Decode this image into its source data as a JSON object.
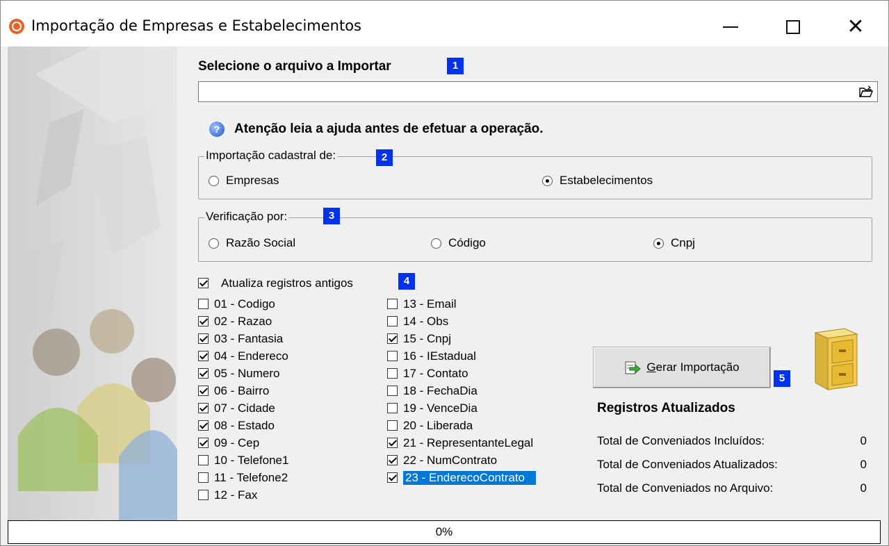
{
  "window": {
    "title": "Importação de Empresas e Estabelecimentos",
    "icons": {
      "app": "app-icon",
      "minimize": "minimize-icon",
      "maximize": "maximize-icon",
      "close": "close-icon"
    }
  },
  "file": {
    "heading": "Selecione o arquivo a Importar",
    "badge": "1",
    "value": "",
    "browse_icon": "open-folder-icon"
  },
  "help": {
    "text": "Atenção leia a ajuda antes de efetuar a operação.",
    "icon": "help-icon"
  },
  "import_type": {
    "legend": "Importação cadastral de:",
    "badge": "2",
    "options": [
      {
        "label": "Empresas",
        "selected": false
      },
      {
        "label": "Estabelecimentos",
        "selected": true
      }
    ]
  },
  "verification": {
    "legend": "Verificação por:",
    "badge": "3",
    "options": [
      {
        "label": "Razão Social",
        "selected": false
      },
      {
        "label": "Código",
        "selected": false
      },
      {
        "label": "Cnpj",
        "selected": true
      }
    ]
  },
  "update_old": {
    "label": "Atualiza registros antigos",
    "checked": true,
    "badge": "4"
  },
  "fields": {
    "left": [
      {
        "label": "01 - Codigo",
        "checked": false
      },
      {
        "label": "02 - Razao",
        "checked": true
      },
      {
        "label": "03 - Fantasia",
        "checked": true
      },
      {
        "label": "04 - Endereco",
        "checked": true
      },
      {
        "label": "05 - Numero",
        "checked": true
      },
      {
        "label": "06 - Bairro",
        "checked": true
      },
      {
        "label": "07 - Cidade",
        "checked": true
      },
      {
        "label": "08 - Estado",
        "checked": true
      },
      {
        "label": "09 - Cep",
        "checked": true
      },
      {
        "label": "10 - Telefone1",
        "checked": false
      },
      {
        "label": "11 - Telefone2",
        "checked": false
      },
      {
        "label": "12 - Fax",
        "checked": false
      }
    ],
    "right": [
      {
        "label": "13 - Email",
        "checked": false
      },
      {
        "label": "14 - Obs",
        "checked": false
      },
      {
        "label": "15 - Cnpj",
        "checked": true
      },
      {
        "label": "16 - IEstadual",
        "checked": false
      },
      {
        "label": "17 - Contato",
        "checked": false
      },
      {
        "label": "18 - FechaDia",
        "checked": false
      },
      {
        "label": "19 - VenceDia",
        "checked": false
      },
      {
        "label": "20 - Liberada",
        "checked": false
      },
      {
        "label": "21 - RepresentanteLegal",
        "checked": true
      },
      {
        "label": "22 - NumContrato",
        "checked": true
      },
      {
        "label": "23 - EnderecoContrato",
        "checked": true,
        "selected": true
      }
    ]
  },
  "generate": {
    "label_underlined": "G",
    "label_rest": "erar Importação",
    "badge": "5",
    "icon": "import-arrow-icon",
    "cabinet_icon": "file-cabinet-icon"
  },
  "stats": {
    "title": "Registros Atualizados",
    "rows": [
      {
        "label": "Total de Conveniados Incluídos:",
        "value": "0"
      },
      {
        "label": "Total de Conveniados Atualizados:",
        "value": "0"
      },
      {
        "label": "Total de Conveniados no Arquivo:",
        "value": "0"
      }
    ]
  },
  "progress": {
    "text": "0%",
    "fraction": 0
  },
  "colors": {
    "badge": "#0033ee",
    "selection": "#0078d7",
    "app_icon": "#e8622a"
  }
}
